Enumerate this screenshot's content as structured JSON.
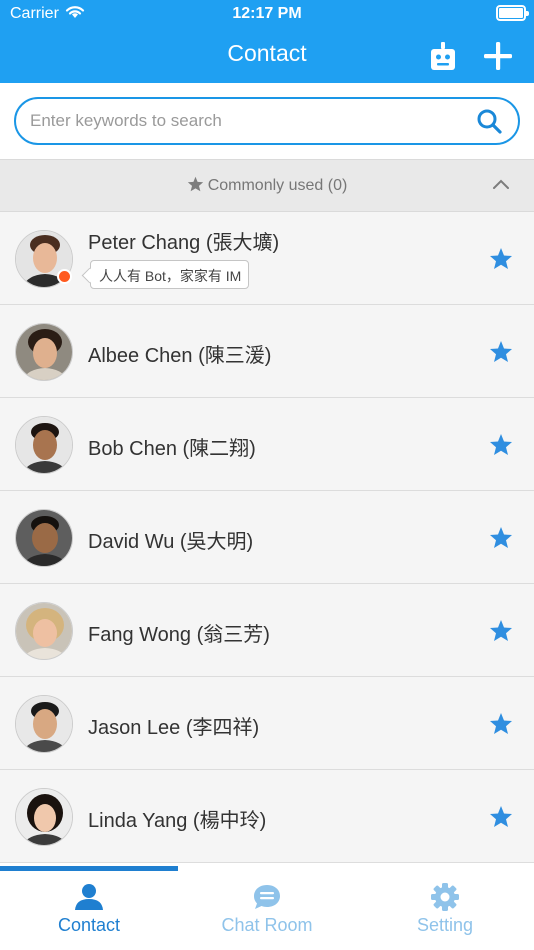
{
  "status_bar": {
    "carrier": "Carrier",
    "time": "12:17 PM"
  },
  "header": {
    "title": "Contact",
    "bot_icon": "robot-icon",
    "add_icon": "plus-icon"
  },
  "search": {
    "placeholder": "Enter keywords to search",
    "value": ""
  },
  "section": {
    "label": "Commonly used (0)",
    "icon": "star-icon",
    "toggle_icon": "chevron-up-icon"
  },
  "contacts": [
    {
      "name": "Peter Chang (張大壙)",
      "status": "人人有 Bot，家家有 IM",
      "online": true,
      "favorite": true
    },
    {
      "name": "Albee Chen (陳三湲)",
      "favorite": true
    },
    {
      "name": "Bob Chen (陳二翔)",
      "favorite": true
    },
    {
      "name": "David Wu (吳大明)",
      "favorite": true
    },
    {
      "name": "Fang Wong (翁三芳)",
      "favorite": true
    },
    {
      "name": "Jason Lee (李四祥)",
      "favorite": true
    },
    {
      "name": "Linda Yang (楊中玲)",
      "favorite": true
    }
  ],
  "tabs": [
    {
      "label": "Contact",
      "icon": "person-icon",
      "active": true
    },
    {
      "label": "Chat Room",
      "icon": "chat-bubble-icon",
      "active": false
    },
    {
      "label": "Setting",
      "icon": "gear-icon",
      "active": false
    }
  ],
  "colors": {
    "header": "#1fa0f2",
    "accent": "#1f7fd0",
    "star": "#2f8ee0",
    "presence": "#ff5a1f"
  }
}
